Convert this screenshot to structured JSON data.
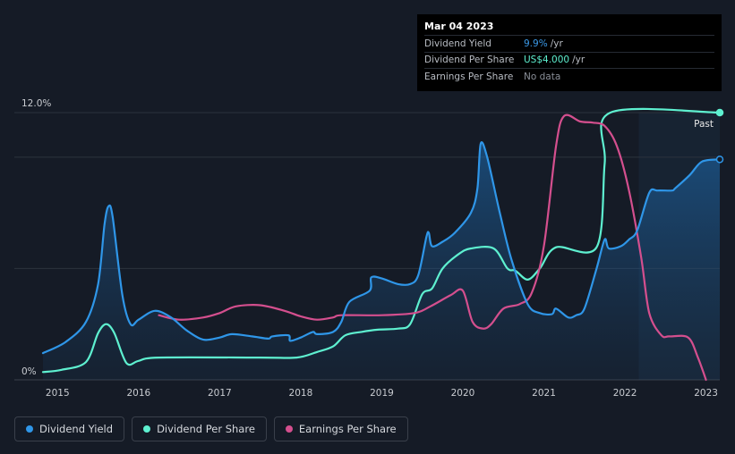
{
  "tooltip": {
    "date": "Mar 04 2023",
    "rows": [
      {
        "label": "Dividend Yield",
        "value": "9.9%",
        "unit": "/yr",
        "color": "#3b9ae8"
      },
      {
        "label": "Dividend Per Share",
        "value": "US$4.000",
        "unit": "/yr",
        "color": "#5ef0d0"
      },
      {
        "label": "Earnings Per Share",
        "value": "No data",
        "unit": "",
        "color": "#8a8f98"
      }
    ]
  },
  "past_label": "Past",
  "legend": [
    {
      "label": "Dividend Yield",
      "color": "#2f96e8"
    },
    {
      "label": "Dividend Per Share",
      "color": "#5ef0d0"
    },
    {
      "label": "Earnings Per Share",
      "color": "#d44f8e"
    }
  ],
  "chart_data": {
    "type": "line",
    "ytick_labels": [
      "12.0%",
      "0%"
    ],
    "xtick_labels": [
      "2015",
      "2016",
      "2017",
      "2018",
      "2019",
      "2020",
      "2021",
      "2022",
      "2023"
    ],
    "ylim": [
      0,
      12
    ],
    "xlim": [
      2014.82,
      2023.17
    ],
    "past_start": 2022.17,
    "series": [
      {
        "name": "Dividend Yield",
        "color": "#2f96e8",
        "fill": true,
        "points": [
          [
            2014.82,
            1.2
          ],
          [
            2015.1,
            1.7
          ],
          [
            2015.35,
            2.6
          ],
          [
            2015.5,
            4.3
          ],
          [
            2015.58,
            7.0
          ],
          [
            2015.63,
            7.8
          ],
          [
            2015.68,
            7.3
          ],
          [
            2015.8,
            3.8
          ],
          [
            2015.9,
            2.5
          ],
          [
            2016.0,
            2.7
          ],
          [
            2016.2,
            3.1
          ],
          [
            2016.4,
            2.8
          ],
          [
            2016.6,
            2.2
          ],
          [
            2016.8,
            1.8
          ],
          [
            2017.0,
            1.9
          ],
          [
            2017.15,
            2.05
          ],
          [
            2017.4,
            1.95
          ],
          [
            2017.6,
            1.85
          ],
          [
            2017.65,
            1.95
          ],
          [
            2017.85,
            2.0
          ],
          [
            2017.87,
            1.75
          ],
          [
            2018.0,
            1.9
          ],
          [
            2018.15,
            2.15
          ],
          [
            2018.2,
            2.05
          ],
          [
            2018.4,
            2.15
          ],
          [
            2018.5,
            2.6
          ],
          [
            2018.6,
            3.5
          ],
          [
            2018.85,
            4.0
          ],
          [
            2018.87,
            4.6
          ],
          [
            2019.0,
            4.55
          ],
          [
            2019.2,
            4.3
          ],
          [
            2019.35,
            4.3
          ],
          [
            2019.45,
            4.7
          ],
          [
            2019.55,
            6.4
          ],
          [
            2019.58,
            6.6
          ],
          [
            2019.62,
            6.0
          ],
          [
            2019.75,
            6.2
          ],
          [
            2019.9,
            6.6
          ],
          [
            2020.1,
            7.5
          ],
          [
            2020.18,
            8.6
          ],
          [
            2020.22,
            10.6
          ],
          [
            2020.3,
            10.0
          ],
          [
            2020.45,
            7.6
          ],
          [
            2020.6,
            5.4
          ],
          [
            2020.8,
            3.4
          ],
          [
            2020.95,
            3.0
          ],
          [
            2021.1,
            2.95
          ],
          [
            2021.15,
            3.2
          ],
          [
            2021.3,
            2.8
          ],
          [
            2021.4,
            2.9
          ],
          [
            2021.5,
            3.2
          ],
          [
            2021.65,
            5.0
          ],
          [
            2021.75,
            6.3
          ],
          [
            2021.8,
            5.9
          ],
          [
            2021.95,
            6.0
          ],
          [
            2022.05,
            6.3
          ],
          [
            2022.15,
            6.7
          ],
          [
            2022.3,
            8.4
          ],
          [
            2022.4,
            8.5
          ],
          [
            2022.58,
            8.5
          ],
          [
            2022.62,
            8.6
          ],
          [
            2022.8,
            9.2
          ],
          [
            2022.95,
            9.8
          ],
          [
            2023.17,
            9.9
          ]
        ]
      },
      {
        "name": "Dividend Per Share",
        "color": "#5ef0d0",
        "fill": false,
        "points": [
          [
            2014.82,
            0.35
          ],
          [
            2015.05,
            0.45
          ],
          [
            2015.35,
            0.8
          ],
          [
            2015.5,
            2.1
          ],
          [
            2015.6,
            2.5
          ],
          [
            2015.7,
            2.1
          ],
          [
            2015.85,
            0.75
          ],
          [
            2016.0,
            0.85
          ],
          [
            2016.25,
            1.0
          ],
          [
            2017.5,
            1.0
          ],
          [
            2017.95,
            1.0
          ],
          [
            2018.2,
            1.25
          ],
          [
            2018.4,
            1.5
          ],
          [
            2018.55,
            2.0
          ],
          [
            2018.75,
            2.15
          ],
          [
            2018.95,
            2.25
          ],
          [
            2019.2,
            2.3
          ],
          [
            2019.35,
            2.5
          ],
          [
            2019.5,
            3.85
          ],
          [
            2019.62,
            4.1
          ],
          [
            2019.75,
            5.0
          ],
          [
            2019.95,
            5.65
          ],
          [
            2020.1,
            5.9
          ],
          [
            2020.38,
            5.9
          ],
          [
            2020.55,
            5.0
          ],
          [
            2020.65,
            4.9
          ],
          [
            2020.8,
            4.5
          ],
          [
            2020.95,
            5.0
          ],
          [
            2021.15,
            5.95
          ],
          [
            2021.65,
            5.95
          ],
          [
            2021.75,
            9.7
          ],
          [
            2021.82,
            12.0
          ],
          [
            2023.17,
            12.0
          ]
        ]
      },
      {
        "name": "Earnings Per Share",
        "color": "#d44f8e",
        "fill": false,
        "points": [
          [
            2016.25,
            2.9
          ],
          [
            2016.5,
            2.7
          ],
          [
            2016.8,
            2.8
          ],
          [
            2017.0,
            3.0
          ],
          [
            2017.2,
            3.3
          ],
          [
            2017.5,
            3.35
          ],
          [
            2017.8,
            3.1
          ],
          [
            2018.0,
            2.85
          ],
          [
            2018.2,
            2.7
          ],
          [
            2018.4,
            2.8
          ],
          [
            2018.5,
            2.9
          ],
          [
            2019.0,
            2.9
          ],
          [
            2019.4,
            3.0
          ],
          [
            2019.6,
            3.3
          ],
          [
            2019.85,
            3.8
          ],
          [
            2020.0,
            4.0
          ],
          [
            2020.12,
            2.6
          ],
          [
            2020.25,
            2.3
          ],
          [
            2020.35,
            2.5
          ],
          [
            2020.5,
            3.2
          ],
          [
            2020.7,
            3.4
          ],
          [
            2020.85,
            3.9
          ],
          [
            2021.0,
            6.0
          ],
          [
            2021.15,
            10.5
          ],
          [
            2021.25,
            11.85
          ],
          [
            2021.45,
            11.6
          ],
          [
            2021.6,
            11.55
          ],
          [
            2021.75,
            11.4
          ],
          [
            2021.9,
            10.5
          ],
          [
            2022.05,
            8.5
          ],
          [
            2022.2,
            5.5
          ],
          [
            2022.3,
            3.0
          ],
          [
            2022.45,
            2.0
          ],
          [
            2022.55,
            1.95
          ],
          [
            2022.78,
            1.9
          ],
          [
            2022.9,
            1.0
          ],
          [
            2023.0,
            0.0
          ]
        ]
      }
    ]
  }
}
